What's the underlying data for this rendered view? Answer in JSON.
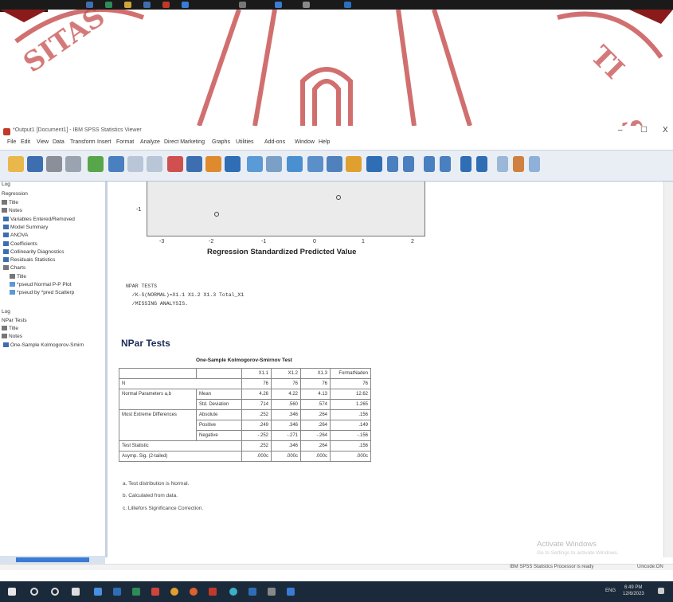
{
  "window": {
    "title": "*Output1 [Document1] - IBM SPSS Statistics Viewer",
    "minimize": "–",
    "maximize": "☐",
    "close": "X"
  },
  "menu": [
    "File",
    "Edit",
    "View",
    "Data",
    "Transform",
    "Insert",
    "Format",
    "Analyze",
    "Direct Marketing",
    "Graphs",
    "Utilities",
    "Add-ons",
    "Window",
    "Help"
  ],
  "nav": {
    "items": [
      "Log",
      "Regression",
      "Title",
      "Notes",
      "Variables Entered/Removed",
      "Model Summary",
      "ANOVA",
      "Coefficients",
      "Collinearity Diagnostics",
      "Residuals Statistics",
      "Charts",
      "Title",
      "*pseud Normal P-P Plot",
      "*pseud by *pred Scatterp",
      "Log",
      "NPar Tests",
      "Title",
      "Notes",
      "One-Sample Kolmogorov-Smirn"
    ]
  },
  "chart": {
    "xlabel": "Regression Standardized Predicted Value",
    "ytick": "-1",
    "xticks": [
      "-3",
      "-2",
      "-1",
      "0",
      "1",
      "2"
    ]
  },
  "chart_data": {
    "type": "scatter",
    "xlabel": "Regression Standardized Predicted Value",
    "x": [
      -1.9,
      0.5
    ],
    "y": [
      -0.6,
      0.9
    ],
    "xlim": [
      -3,
      2
    ]
  },
  "syntax": {
    "line1": "NPAR TESTS",
    "line2": "  /K-S(NORMAL)=X1.1 X1.2 X1.3 Total_X1",
    "line3": "  /MISSING ANALYSIS."
  },
  "output": {
    "heading": "NPar Tests",
    "table_caption": "One-Sample Kolmogorov-Smirnov Test",
    "columns": [
      "X1.1",
      "X1.2",
      "X1.3",
      "FormatNaden"
    ],
    "rows": [
      {
        "label": "N",
        "sub": "",
        "values": [
          "76",
          "76",
          "76",
          "76"
        ]
      },
      {
        "label": "Normal Parameters a,b",
        "sub": "Mean",
        "values": [
          "4.26",
          "4.22",
          "4.13",
          "12.62"
        ]
      },
      {
        "label": "",
        "sub": "Std. Deviation",
        "values": [
          ".714",
          ".560",
          ".574",
          "1.265"
        ]
      },
      {
        "label": "Most Extreme Differences",
        "sub": "Absolute",
        "values": [
          ".252",
          ".346",
          ".264",
          ".156"
        ]
      },
      {
        "label": "",
        "sub": "Positive",
        "values": [
          ".249",
          ".346",
          ".264",
          ".149"
        ]
      },
      {
        "label": "",
        "sub": "Negative",
        "values": [
          "-.252",
          "-.271",
          "-.264",
          "-.156"
        ]
      },
      {
        "label": "Test Statistic",
        "sub": "",
        "values": [
          ".252",
          ".346",
          ".264",
          ".156"
        ]
      },
      {
        "label": "Asymp. Sig. (2-tailed)",
        "sub": "",
        "values": [
          ".000c",
          ".000c",
          ".000c",
          ".000c"
        ]
      }
    ],
    "footnotes": [
      "a. Test distribution is Normal.",
      "b. Calculated from data.",
      "c. Lilliefors Significance Correction."
    ]
  },
  "activate": {
    "title": "Activate Windows",
    "sub": "Go to Settings to activate Windows."
  },
  "status": {
    "processor": "IBM SPSS Statistics Processor is ready",
    "encoding": "Unicode:ON"
  },
  "taskbar": {
    "time": "6:49 PM",
    "date": "12/6/2023",
    "lang": "ENG"
  },
  "colors": {
    "watermark": "#c24040",
    "toolbar": "#e9eef5",
    "taskbar": "#1b2a3a"
  }
}
